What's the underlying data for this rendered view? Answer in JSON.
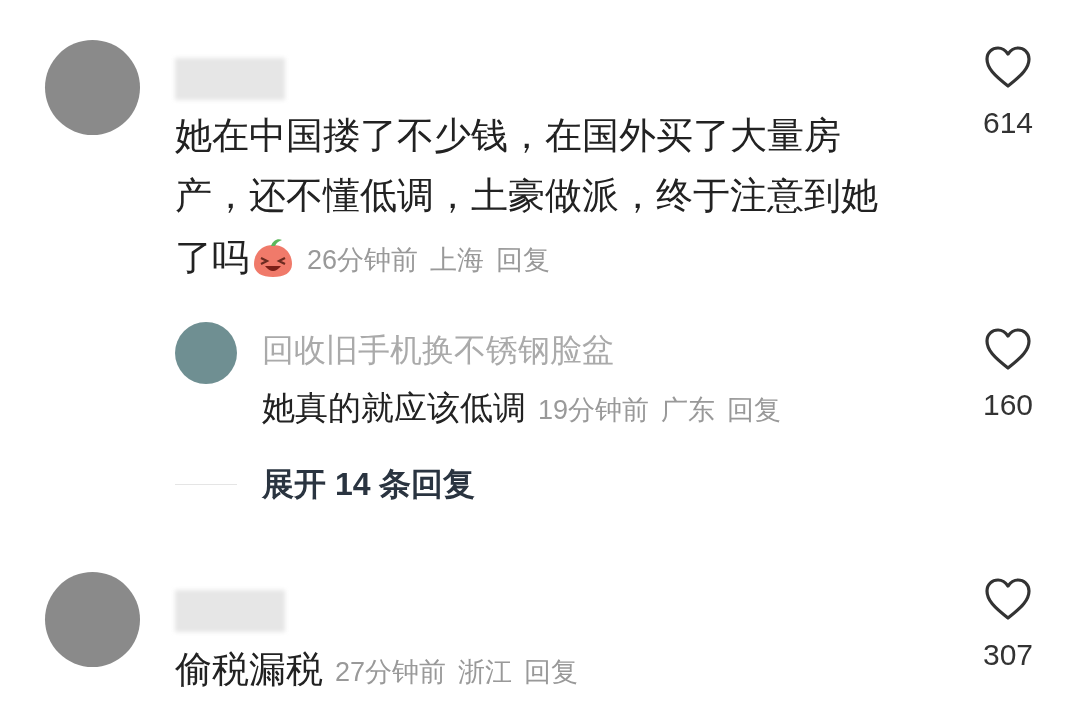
{
  "comments": [
    {
      "text": "她在中国搂了不少钱，在国外买了大量房产，还不懂低调，土豪做派，终于注意到她了吗",
      "has_emoji": true,
      "time": "26分钟前",
      "location": "上海",
      "reply_label": "回复",
      "likes": "614",
      "replies": [
        {
          "username": "回收旧手机换不锈钢脸盆",
          "text": "她真的就应该低调",
          "time": "19分钟前",
          "location": "广东",
          "reply_label": "回复",
          "likes": "160"
        }
      ],
      "expand_label": "展开 14 条回复"
    },
    {
      "text": "偷税漏税",
      "time": "27分钟前",
      "location": "浙江",
      "reply_label": "回复",
      "likes": "307"
    }
  ]
}
